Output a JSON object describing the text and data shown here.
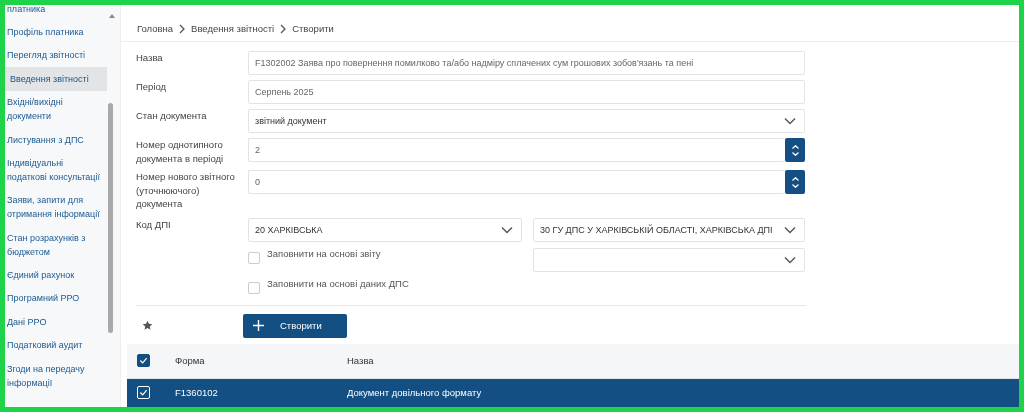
{
  "sidebar": {
    "items": [
      {
        "label": "платника",
        "selected": false
      },
      {
        "label": "Профіль платника",
        "selected": false
      },
      {
        "label": "Перегляд звітності",
        "selected": false
      },
      {
        "label": "Введення звітності",
        "selected": true
      },
      {
        "label": "Вхідні/вихідні документи",
        "selected": false
      },
      {
        "label": "Листування з ДПС",
        "selected": false
      },
      {
        "label": "Індивідуальні податкові консультації",
        "selected": false
      },
      {
        "label": "Заяви, запити для отримання інформації",
        "selected": false
      },
      {
        "label": "Стан розрахунків з бюджетом",
        "selected": false
      },
      {
        "label": "Єдиний рахунок",
        "selected": false
      },
      {
        "label": "Програмний РРО",
        "selected": false
      },
      {
        "label": "Дані РРО",
        "selected": false
      },
      {
        "label": "Податковий аудит",
        "selected": false
      },
      {
        "label": "Згоди на передачу інформації",
        "selected": false
      }
    ]
  },
  "breadcrumbs": [
    "Головна",
    "Введення звітності",
    "Створити"
  ],
  "form": {
    "fields": [
      {
        "label": "Назва",
        "kind": "text",
        "value": "F1302002 Заява про повернення помилково та/або надміру сплачених сум грошових зобов'язань та пені"
      },
      {
        "label": "Період",
        "kind": "text",
        "value": "Серпень 2025"
      },
      {
        "label": "Стан документа",
        "kind": "select",
        "value": "звітний документ"
      },
      {
        "label": "Номер однотипного документа в періоді",
        "kind": "number",
        "value": "2"
      },
      {
        "label": "Номер нового звітного (уточнюючого) документа",
        "kind": "number",
        "value": "0"
      }
    ],
    "dpi": {
      "label": "Код ДПІ",
      "region": "20 ХАРКІВСЬКА",
      "office": "30 ГУ ДПС У ХАРКІВСЬКІЙ ОБЛАСТІ, ХАРКІВСЬКА ДПІ",
      "options": [
        {
          "label": "Заповнити на основі звіту",
          "checked": false
        },
        {
          "label": "Заповнити на основі даних ДПС",
          "checked": false
        }
      ]
    }
  },
  "create_button": "Створити",
  "table": {
    "columns": [
      "Форма",
      "Назва"
    ],
    "all_checked": true,
    "rows": [
      {
        "form": "F1360102",
        "name": "Документ довільного формату",
        "selected": true,
        "checked": true
      }
    ]
  }
}
